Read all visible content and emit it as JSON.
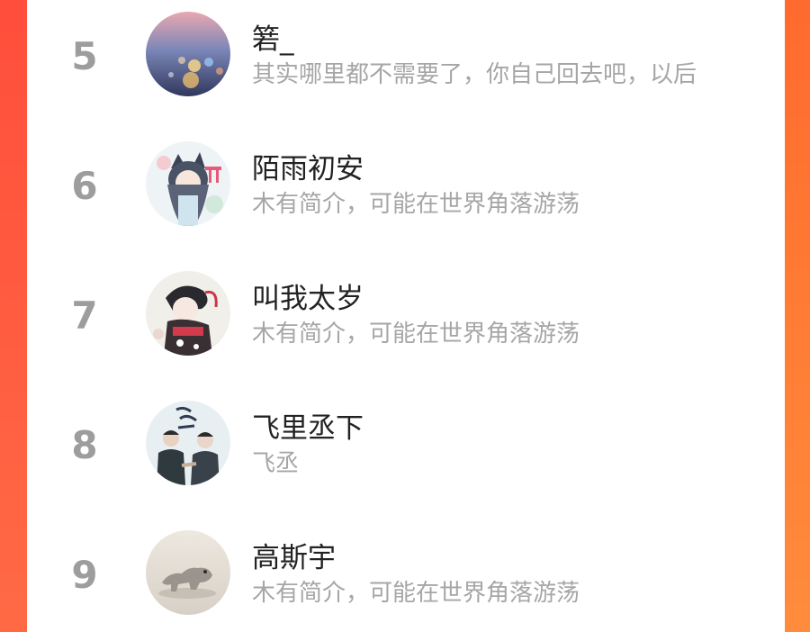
{
  "colors": {
    "accent_left": "#ff5040",
    "accent_right": "#ff7a30",
    "rank": "#9d9d9d",
    "name": "#222222",
    "desc": "#a6a6a6"
  },
  "users": [
    {
      "rank": "5",
      "name": "箬_",
      "desc": "其实哪里都不需要了，你自己回去吧，以后",
      "avatar_icon": "bokeh-night-avatar"
    },
    {
      "rank": "6",
      "name": "陌雨初安",
      "desc": "木有简介，可能在世界角落游荡",
      "avatar_icon": "anime-girl-avatar"
    },
    {
      "rank": "7",
      "name": "叫我太岁",
      "desc": "木有简介，可能在世界角落游荡",
      "avatar_icon": "anime-character-avatar"
    },
    {
      "rank": "8",
      "name": "飞里丞下",
      "desc": "飞丞",
      "avatar_icon": "two-men-avatar"
    },
    {
      "rank": "9",
      "name": "高斯宇",
      "desc": "木有简介，可能在世界角落游荡",
      "avatar_icon": "toy-dinosaur-avatar"
    }
  ]
}
